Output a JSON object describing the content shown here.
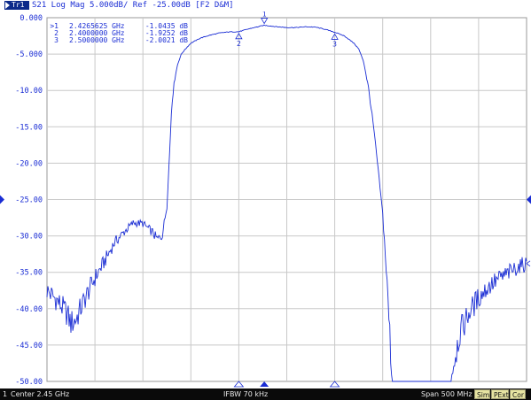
{
  "title_bar": {
    "trace_badge": "Tr1",
    "title": "S21 Log Mag 5.000dB/ Ref -25.00dB [F2 D&M]"
  },
  "marker_table": [
    {
      "id": ">1",
      "freq": "2.4265625 GHz",
      "value": "-1.0435 dB"
    },
    {
      "id": "2",
      "freq": "2.4000000 GHz",
      "value": "-1.9252 dB"
    },
    {
      "id": "3",
      "freq": "2.5000000 GHz",
      "value": "-2.0021 dB"
    }
  ],
  "status_bar": {
    "channel": "1",
    "center": "Center 2.45 GHz",
    "ifbw": "IFBW 70 kHz",
    "span": "Span 500 MHz",
    "buttons": {
      "sim": "Sim",
      "pext": "PExt",
      "cor": "Cor"
    }
  },
  "colors": {
    "trace": "#1a2dd4",
    "grid": "#c8c8c8",
    "background": "#ffffff",
    "status_bar": "#0a0a0a",
    "status_button": "#e7e4a2"
  },
  "chart_data": {
    "type": "line",
    "title": "S21 Log Mag 5.000dB/ Ref -25.00dB [F2 D&M]",
    "x_unit": "GHz",
    "xlim": [
      2.2,
      2.7
    ],
    "ylim": [
      -50,
      0
    ],
    "y_ticks": [
      "0.000",
      "-5.000",
      "-10.00",
      "-15.00",
      "-20.00",
      "-25.00",
      "-30.00",
      "-35.00",
      "-40.00",
      "-45.00",
      "-50.00"
    ],
    "reference_level": -25,
    "scale_per_div": 5,
    "grid": true,
    "series": [
      {
        "x": [
          2.2,
          2.21,
          2.22,
          2.225,
          2.23,
          2.24,
          2.25,
          2.26,
          2.27,
          2.28,
          2.29,
          2.3,
          2.31,
          2.315,
          2.32,
          2.325,
          2.328,
          2.33,
          2.333,
          2.336,
          2.34,
          2.345,
          2.35,
          2.36,
          2.37,
          2.38,
          2.39,
          2.4,
          2.41,
          2.4266,
          2.44,
          2.45,
          2.46,
          2.47,
          2.48,
          2.49,
          2.5,
          2.51,
          2.52,
          2.525,
          2.53,
          2.535,
          2.54,
          2.545,
          2.55,
          2.553,
          2.556,
          2.56,
          2.62,
          2.626,
          2.63,
          2.64,
          2.65,
          2.66,
          2.67,
          2.68,
          2.69,
          2.7
        ],
        "y": [
          -37.5,
          -38.8,
          -40.5,
          -42.0,
          -41.5,
          -38.5,
          -35.8,
          -33.5,
          -31.0,
          -29.5,
          -28.2,
          -28.3,
          -29.5,
          -30.5,
          -30.0,
          -26.0,
          -18.0,
          -12.0,
          -8.5,
          -6.5,
          -5.0,
          -4.2,
          -3.5,
          -2.8,
          -2.4,
          -2.1,
          -1.95,
          -1.93,
          -1.55,
          -1.04,
          -1.25,
          -1.35,
          -1.35,
          -1.25,
          -1.3,
          -1.6,
          -2.0,
          -2.5,
          -3.5,
          -4.3,
          -6.0,
          -9.5,
          -14.5,
          -20.5,
          -27.0,
          -33.0,
          -40.0,
          -50.0,
          -50.0,
          -46.0,
          -43.5,
          -40.5,
          -38.5,
          -37.0,
          -36.0,
          -35.2,
          -34.3,
          -33.8
        ]
      }
    ],
    "markers": [
      {
        "id": "1",
        "x": 2.4265625,
        "y": -1.0435,
        "active": true
      },
      {
        "id": "2",
        "x": 2.4,
        "y": -1.9252
      },
      {
        "id": "3",
        "x": 2.5,
        "y": -2.0021
      }
    ]
  }
}
